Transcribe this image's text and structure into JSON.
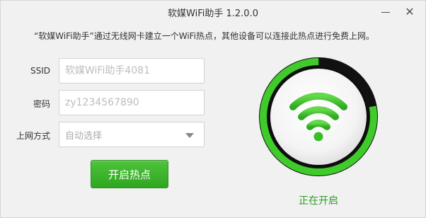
{
  "window": {
    "title": "软媒WiFi助手 1.2.0.0",
    "minimize_label": "—",
    "close_label": "✕"
  },
  "description": "“软媒WiFi助手”通过无线网卡建立一个WiFi热点，其他设备可以连接此热点进行免费上网。",
  "form": {
    "ssid_label": "SSID",
    "ssid_placeholder": "软媒WiFi助手4081",
    "password_label": "密码",
    "password_placeholder": "zy1234567890",
    "mode_label": "上网方式",
    "mode_value": "自动选择"
  },
  "start_button_label": "开启热点",
  "status_text": "正在开启",
  "progress": 0.78,
  "colors": {
    "accent_green": "#3fbf2c",
    "ring_dark": "#1a1a1a",
    "status_green": "#2f9b22"
  },
  "icons": [
    "wifi-icon",
    "chevron-down-icon",
    "close-icon",
    "minimize-icon"
  ]
}
